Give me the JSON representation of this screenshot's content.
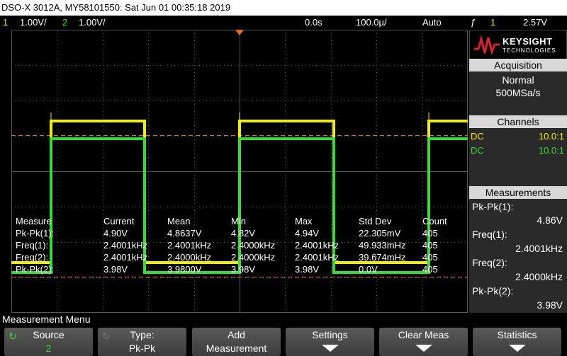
{
  "titlebar": "DSO-X 3012A, MY58101550: Sat Jun 01 00:35:18 2019",
  "status": {
    "ch1_num": "1",
    "ch1_scale": "1.00V/",
    "ch2_num": "2",
    "ch2_scale": "1.00V/",
    "time_offset": "0.0s",
    "time_scale": "100.0µ/",
    "trigger_mode": "Auto",
    "trigger_icon": "trigger-edge-icon",
    "trigger_glyph": "ƒ",
    "trigger_ch": "1",
    "trigger_level": "2.57V"
  },
  "colors": {
    "ch1": "#f0f000",
    "ch2": "#33dd33",
    "grid": "#555555",
    "marker": "#e07020"
  },
  "measure_table": {
    "headers": [
      "Measure",
      "Current",
      "Mean",
      "Min",
      "Max",
      "Std Dev",
      "Count"
    ],
    "rows": [
      [
        "Pk-Pk(1):",
        "4.90V",
        "4.8637V",
        "4.82V",
        "4.94V",
        "22.305mV",
        "405"
      ],
      [
        "Freq(1):",
        "2.4001kHz",
        "2.4001kHz",
        "2.4000kHz",
        "2.4001kHz",
        "49.933mHz",
        "405"
      ],
      [
        "Freq(2):",
        "2.4001kHz",
        "2.4000kHz",
        "2.4000kHz",
        "2.4001kHz",
        "39.674mHz",
        "405"
      ],
      [
        "Pk-Pk(2):",
        "3.98V",
        "3.9800V",
        "3.98V",
        "3.98V",
        "0.0V",
        "405"
      ]
    ]
  },
  "logo": {
    "name": "KEYSIGHT",
    "sub": "TECHNOLOGIES"
  },
  "acquisition": {
    "title": "Acquisition",
    "mode": "Normal",
    "rate": "500MSa/s"
  },
  "channels": {
    "title": "Channels",
    "items": [
      {
        "coupling": "DC",
        "probe": "10.0:1"
      },
      {
        "coupling": "DC",
        "probe": "10.0:1"
      }
    ]
  },
  "measurements": {
    "title": "Measurements",
    "items": [
      {
        "label": "Pk-Pk(1):",
        "value": "4.86V"
      },
      {
        "label": "Freq(1):",
        "value": "2.4001kHz"
      },
      {
        "label": "Freq(2):",
        "value": "2.4000kHz"
      },
      {
        "label": "Pk-Pk(2):",
        "value": "3.98V"
      }
    ]
  },
  "menu_title": "Measurement Menu",
  "softkeys": [
    {
      "line1": "Source",
      "line2": "2"
    },
    {
      "line1": "Type:",
      "line2": "Pk-Pk"
    },
    {
      "line1": "Add",
      "line2": "Measurement"
    },
    {
      "line1": "Settings",
      "line2": ""
    },
    {
      "line1": "Clear Meas",
      "line2": ""
    },
    {
      "line1": "Statistics",
      "line2": ""
    }
  ],
  "markers": {
    "ch1_ground": "1",
    "ch2_ground": "2",
    "trigger_marker": "T"
  }
}
